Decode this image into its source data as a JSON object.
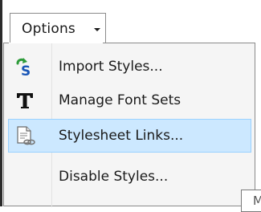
{
  "options_button": {
    "label": "Options"
  },
  "menu": {
    "items": [
      {
        "label": "Import Styles...",
        "icon": "import-styles-icon"
      },
      {
        "label": "Manage Font Sets",
        "icon": "font-sets-icon"
      },
      {
        "label": "Stylesheet Links...",
        "icon": "stylesheet-links-icon",
        "highlighted": true
      },
      {
        "label": "Disable Styles...",
        "icon": ""
      }
    ]
  },
  "tooltip": {
    "text": "M"
  },
  "colors": {
    "menu_background": "#f5f5f5",
    "highlight_background": "#cce8ff",
    "highlight_border": "#99d1ff",
    "icon_green": "#2e9b3a",
    "icon_blue": "#1b57b7"
  }
}
